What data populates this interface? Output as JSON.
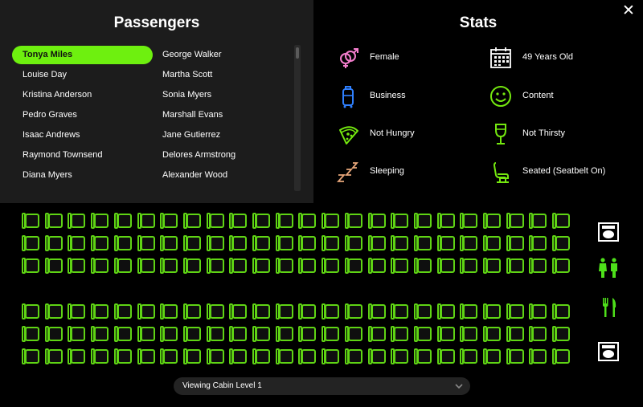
{
  "passengers": {
    "title": "Passengers",
    "selected_index": 0,
    "items": [
      "Tonya Miles",
      "George Walker",
      "Louise Day",
      "Martha Scott",
      "Kristina Anderson",
      "Sonia Myers",
      "Pedro Graves",
      "Marshall Evans",
      "Isaac Andrews",
      "Jane Gutierrez",
      "Raymond Townsend",
      "Delores Armstrong",
      "Diana Myers",
      "Alexander Wood"
    ]
  },
  "stats": {
    "title": "Stats",
    "items": [
      {
        "icon": "gender-female-male-icon",
        "label": "Female",
        "color": "#f47ecd"
      },
      {
        "icon": "calendar-icon",
        "label": "49 Years Old",
        "color": "#ffffff"
      },
      {
        "icon": "suitcase-icon",
        "label": "Business",
        "color": "#2f80ff"
      },
      {
        "icon": "smiley-face-icon",
        "label": "Content",
        "color": "#74e80f"
      },
      {
        "icon": "pizza-slice-icon",
        "label": "Not Hungry",
        "color": "#74e80f"
      },
      {
        "icon": "wine-glass-icon",
        "label": "Not Thirsty",
        "color": "#74e80f"
      },
      {
        "icon": "sleep-zzz-icon",
        "label": "Sleeping",
        "color": "#e7a67a"
      },
      {
        "icon": "airplane-seat-icon",
        "label": "Seated (Seatbelt On)",
        "color": "#74e80f"
      }
    ]
  },
  "cabin": {
    "seats_per_row": 24,
    "row_count": 6,
    "seat_color": "#5fd414",
    "facilities": [
      "lavatory-icon",
      "restroom-icon",
      "galley-icon",
      "lavatory-icon"
    ]
  },
  "cabin_select": {
    "label": "Viewing Cabin Level 1"
  },
  "colors": {
    "accent": "#6ef00f",
    "panel": "#1c1c1c"
  }
}
